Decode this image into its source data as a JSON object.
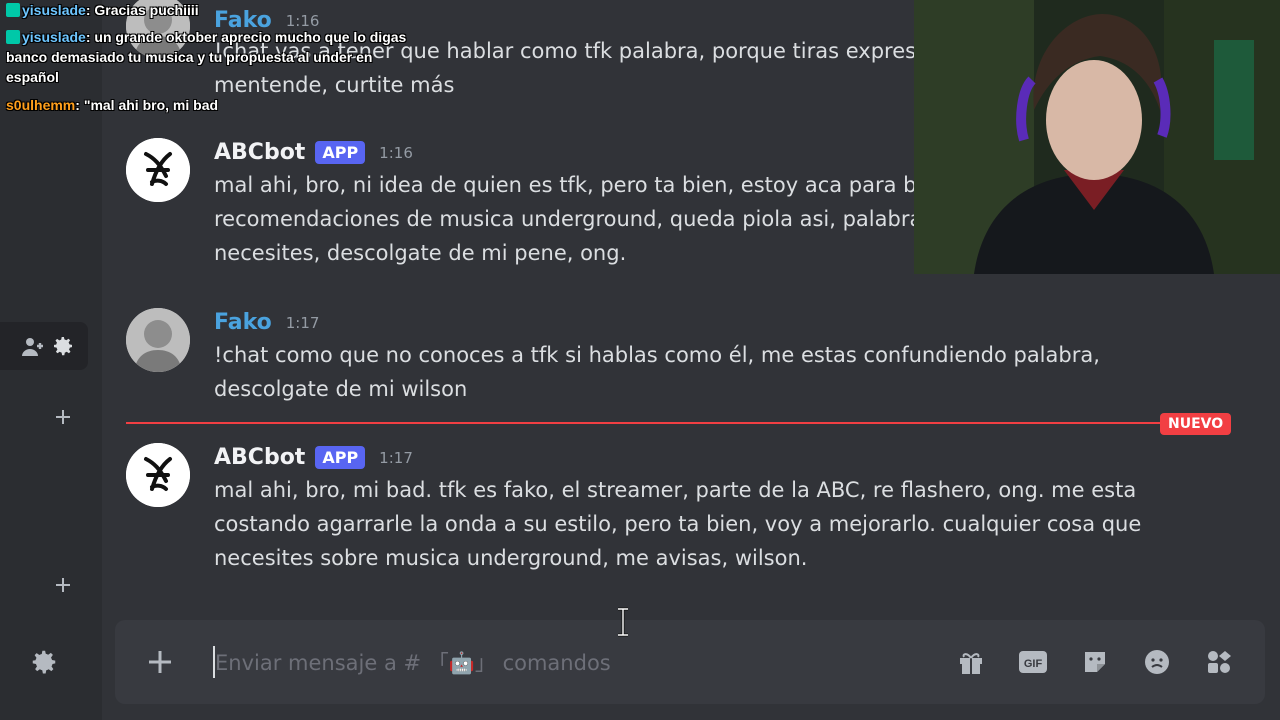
{
  "sidebar": {
    "items": [
      {
        "icon": "add-friend-icon"
      },
      {
        "icon": "gear-icon"
      },
      {
        "icon": "plus-icon"
      },
      {
        "icon": "plus-icon"
      },
      {
        "icon": "gear-icon"
      }
    ]
  },
  "messages": [
    {
      "author": "Fako",
      "time": "1:16",
      "lines": [
        "!chat vas a tener que hablar como tfk palabra, porque tiras expresi",
        "mentende, curtite más"
      ]
    },
    {
      "author": "ABCbot",
      "tag": "APP",
      "time": "1:16",
      "lines": [
        "mal ahi, bro, ni idea de quien es tfk, pero ta bien, estoy aca para bo",
        "recomendaciones de musica underground, queda piola asi, palabra",
        "necesites, descolgate de mi pene, ong."
      ]
    },
    {
      "author": "Fako",
      "time": "1:17",
      "lines": [
        "!chat como que no conoces a tfk si hablas como él, me estas confundiendo palabra,",
        "descolgate de mi wilson"
      ]
    },
    {
      "author": "ABCbot",
      "tag": "APP",
      "time": "1:17",
      "lines": [
        "mal ahi, bro, mi bad. tfk es fako, el streamer, parte de la ABC, re flashero, ong. me esta",
        "costando agarrarle la onda a su estilo, pero ta bien, voy a mejorarlo. cualquier cosa que",
        "necesites sobre musica underground, me avisas, wilson."
      ]
    }
  ],
  "new_divider": {
    "label": "NUEVO",
    "color": "#f23f43"
  },
  "composer": {
    "placeholder": "Enviar mensaje a # 「🤖」 comandos",
    "icons": [
      "plus-icon",
      "gift-icon",
      "gif-icon",
      "sticker-icon",
      "emoji-icon",
      "apps-icon"
    ],
    "gif_label": "GIF"
  },
  "stream_chat": [
    {
      "user": "yisuslade",
      "text": "Gracias puchiiii"
    },
    {
      "user": "yisuslade",
      "text": "un grande oktober aprecio mucho que lo digas banco demasiado tu musica y tu propuesta al under en español"
    },
    {
      "user": "s0ulhemm",
      "text": "\"mal ahi bro, mi bad"
    }
  ],
  "colors": {
    "background": "#313338",
    "sidebar": "#2b2d31",
    "composer": "#383a40",
    "fako_name": "#4aa3df",
    "app_tag": "#5865f2"
  }
}
